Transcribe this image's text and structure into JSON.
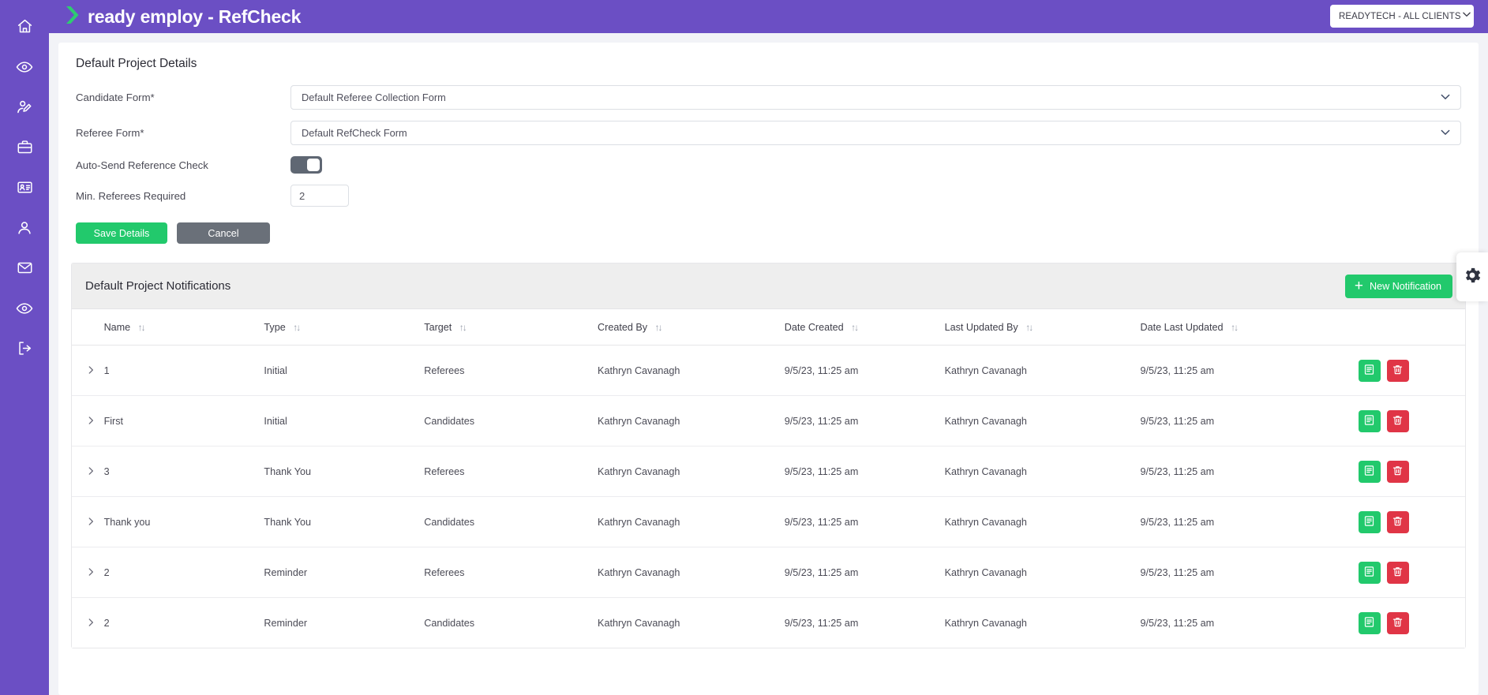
{
  "theme": {
    "brand_purple": "#6b4fc4",
    "accent_green": "#22c96c",
    "danger_red": "#e03546",
    "gray_button": "#6a7079",
    "page_bg": "#f2f3f7"
  },
  "sidebar": {
    "items": [
      {
        "name": "home-icon",
        "label": "Home"
      },
      {
        "name": "eye-icon",
        "label": "View"
      },
      {
        "name": "user-edit-icon",
        "label": "Edit User"
      },
      {
        "name": "briefcase-icon",
        "label": "Jobs"
      },
      {
        "name": "id-card-icon",
        "label": "Candidates"
      },
      {
        "name": "user-icon",
        "label": "Profile"
      },
      {
        "name": "envelope-icon",
        "label": "Messages"
      },
      {
        "name": "eye-icon-2",
        "label": "Preview"
      },
      {
        "name": "logout-icon",
        "label": "Log out"
      }
    ]
  },
  "header": {
    "brand_text": "ready employ - RefCheck",
    "client_select_value": "READYTECH - ALL CLIENTS"
  },
  "details": {
    "section_title": "Default Project Details",
    "fields": {
      "candidate_form_label": "Candidate Form*",
      "candidate_form_value": "Default Referee Collection Form",
      "referee_form_label": "Referee Form*",
      "referee_form_value": "Default RefCheck Form",
      "auto_send_label": "Auto-Send Reference Check",
      "auto_send_state": "on",
      "min_referees_label": "Min. Referees Required",
      "min_referees_value": "2"
    },
    "save_label": "Save Details",
    "cancel_label": "Cancel"
  },
  "notifications": {
    "title": "Default Project Notifications",
    "new_button_label": "New Notification",
    "columns": [
      "Name",
      "Type",
      "Target",
      "Created By",
      "Date Created",
      "Last Updated By",
      "Date Last Updated"
    ],
    "rows": [
      {
        "name": "1",
        "type": "Initial",
        "target": "Referees",
        "created_by": "Kathryn Cavanagh",
        "date_created": "9/5/23, 11:25 am",
        "last_updated_by": "Kathryn Cavanagh",
        "date_last_updated": "9/5/23, 11:25 am"
      },
      {
        "name": "First",
        "type": "Initial",
        "target": "Candidates",
        "created_by": "Kathryn Cavanagh",
        "date_created": "9/5/23, 11:25 am",
        "last_updated_by": "Kathryn Cavanagh",
        "date_last_updated": "9/5/23, 11:25 am"
      },
      {
        "name": "3",
        "type": "Thank You",
        "target": "Referees",
        "created_by": "Kathryn Cavanagh",
        "date_created": "9/5/23, 11:25 am",
        "last_updated_by": "Kathryn Cavanagh",
        "date_last_updated": "9/5/23, 11:25 am"
      },
      {
        "name": "Thank you",
        "type": "Thank You",
        "target": "Candidates",
        "created_by": "Kathryn Cavanagh",
        "date_created": "9/5/23, 11:25 am",
        "last_updated_by": "Kathryn Cavanagh",
        "date_last_updated": "9/5/23, 11:25 am"
      },
      {
        "name": "2",
        "type": "Reminder",
        "target": "Referees",
        "created_by": "Kathryn Cavanagh",
        "date_created": "9/5/23, 11:25 am",
        "last_updated_by": "Kathryn Cavanagh",
        "date_last_updated": "9/5/23, 11:25 am"
      },
      {
        "name": "2",
        "type": "Reminder",
        "target": "Candidates",
        "created_by": "Kathryn Cavanagh",
        "date_created": "9/5/23, 11:25 am",
        "last_updated_by": "Kathryn Cavanagh",
        "date_last_updated": "9/5/23, 11:25 am"
      }
    ]
  },
  "floating": {
    "gear_label": "Settings"
  }
}
